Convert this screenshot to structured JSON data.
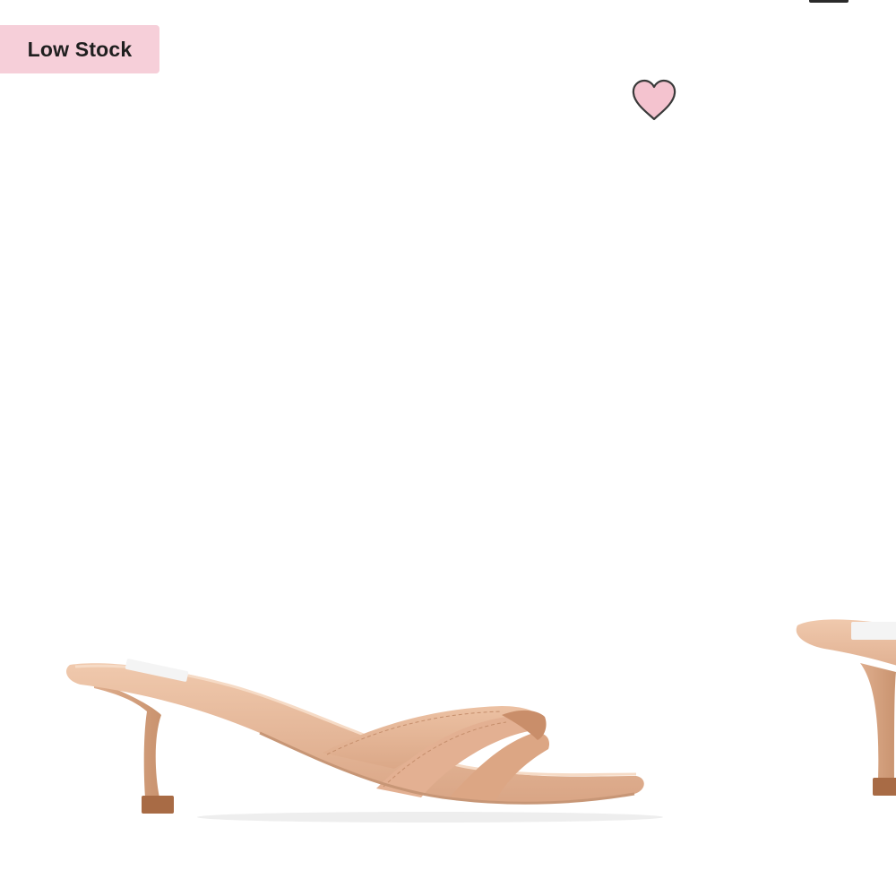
{
  "badge": {
    "label": "Low Stock",
    "background": "#f6cfd9"
  },
  "wishlist": {
    "icon": "heart-icon",
    "fill": "#f4c3cf",
    "stroke": "#3a3a3a"
  },
  "product": {
    "image_icon": "kitten-heel-sandal",
    "color": "#e6b697"
  },
  "carousel": {
    "active_indicator_color": "#2a2a2a"
  }
}
